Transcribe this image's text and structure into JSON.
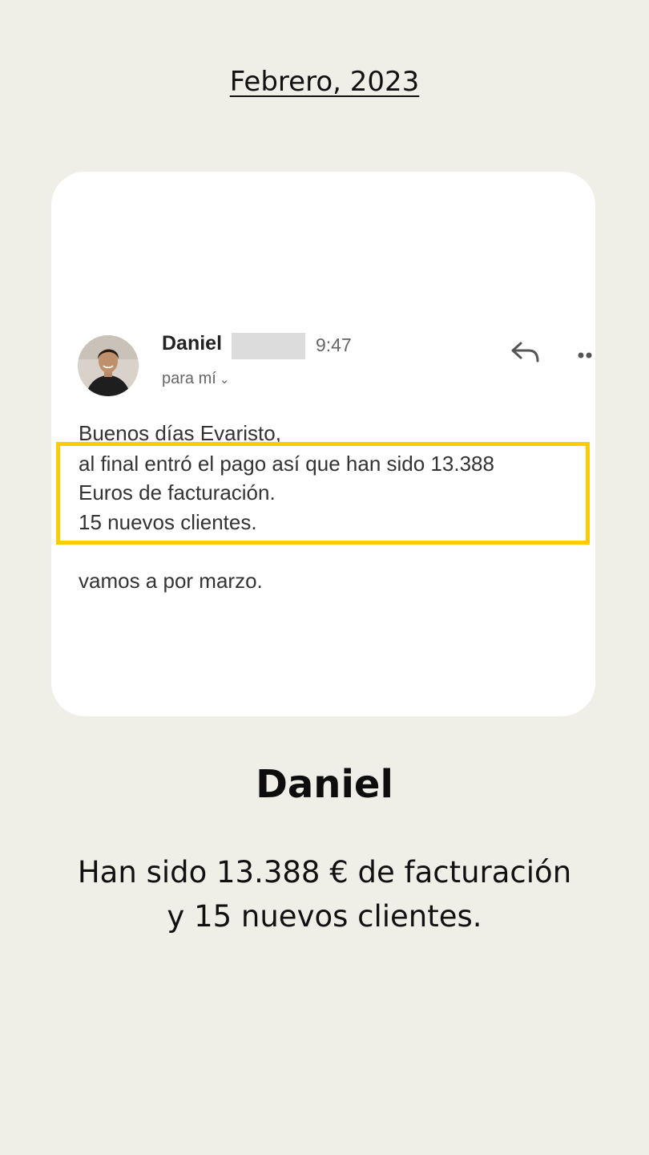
{
  "header": {
    "date": "Febrero, 2023"
  },
  "email": {
    "sender_name": "Daniel",
    "time": "9:47",
    "recipient": "para mí",
    "body": [
      "Buenos días Evaristo,",
      "al final entró el pago así que han sido 13.388",
      "Euros de facturación.",
      "15 nuevos clientes.",
      "vamos a por marzo."
    ],
    "highlight_color": "#ffcc00"
  },
  "caption": {
    "name": "Daniel",
    "line1": "Han sido 13.388 € de facturación",
    "line2": "y 15 nuevos clientes."
  },
  "icons": {
    "reply": "reply-icon",
    "more": "more-icon",
    "chevron": "chevron-down-icon"
  }
}
